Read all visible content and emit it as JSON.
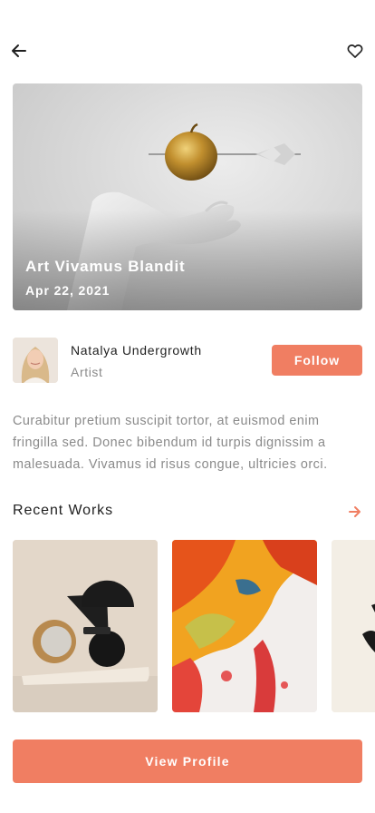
{
  "header": {
    "back_icon": "arrow-left-icon",
    "favorite_icon": "heart-outline-icon"
  },
  "artwork": {
    "title": "Art Vivamus Blandit",
    "date": "Apr 22, 2021"
  },
  "artist": {
    "name": "Natalya Undergrowth",
    "role": "Artist",
    "follow_label": "Follow"
  },
  "description": "Curabitur pretium suscipit tortor, at euismod enim fringilla sed. Donec bibendum id turpis dignissim a malesuada. Vivamus id risus congue, ultricies orci.",
  "recent_works": {
    "title": "Recent Works",
    "see_all_icon": "arrow-right-icon"
  },
  "footer": {
    "view_profile_label": "View Profile"
  },
  "colors": {
    "accent": "#f07e62",
    "text_primary": "#1f1f1f",
    "text_secondary": "#8a8a8a"
  }
}
